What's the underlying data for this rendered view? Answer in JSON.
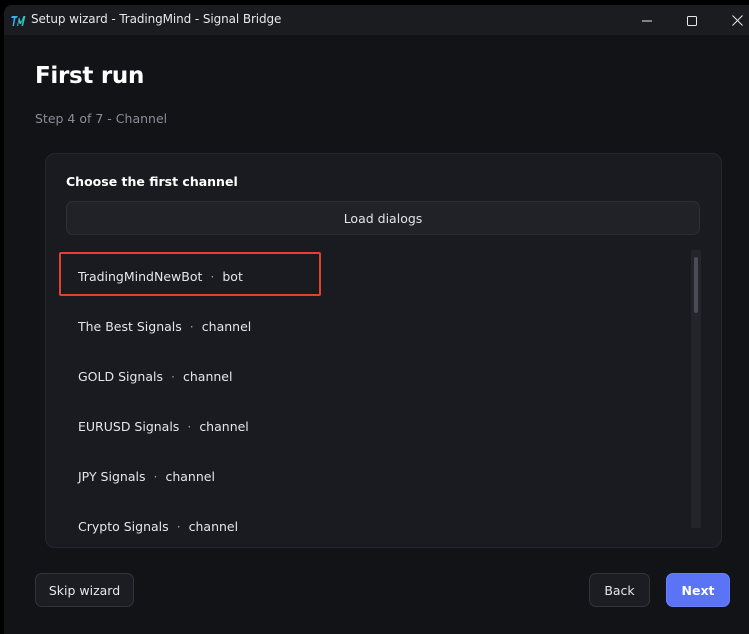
{
  "window": {
    "title": "Setup wizard - TradingMind - Signal Bridge"
  },
  "page": {
    "heading": "First run",
    "step": "Step 4 of 7 - Channel"
  },
  "card": {
    "title": "Choose the first channel",
    "load_button": "Load dialogs"
  },
  "dialogs": [
    {
      "name": "TradingMindNewBot",
      "separator": "·",
      "kind": "bot"
    },
    {
      "name": "The Best Signals",
      "separator": "·",
      "kind": "channel"
    },
    {
      "name": "GOLD Signals",
      "separator": "·",
      "kind": "channel"
    },
    {
      "name": "EURUSD Signals",
      "separator": "·",
      "kind": "channel"
    },
    {
      "name": "JPY Signals",
      "separator": "·",
      "kind": "channel"
    },
    {
      "name": "Crypto Signals",
      "separator": "·",
      "kind": "channel"
    }
  ],
  "footer": {
    "skip": "Skip wizard",
    "back": "Back",
    "next": "Next"
  },
  "icons": {
    "app": "tradingmind-logo-icon",
    "minimize": "minimize-icon",
    "maximize": "maximize-icon",
    "close": "close-icon"
  },
  "colors": {
    "accent": "#5b73f5",
    "highlight": "#e2412e",
    "background": "#121317",
    "card": "#1a1b20"
  }
}
